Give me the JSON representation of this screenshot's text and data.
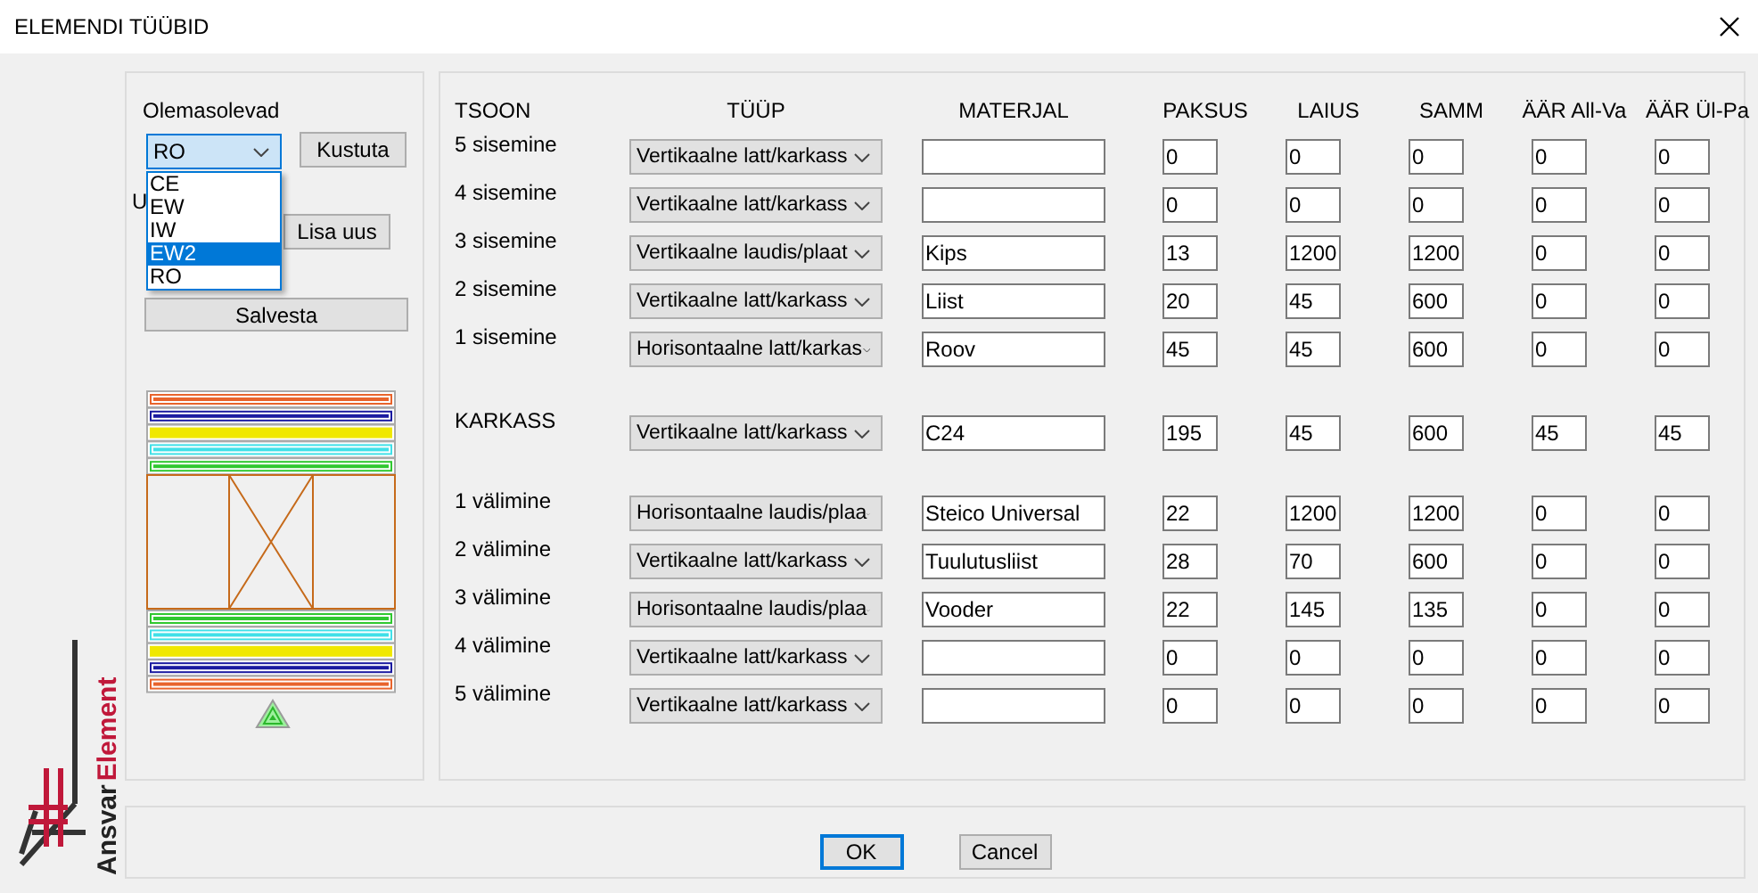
{
  "window": {
    "title": "ELEMENDI TÜÜBID"
  },
  "existing": {
    "label": "Olemasolevad",
    "value": "RO",
    "expanded": true,
    "options": [
      {
        "label": "CE",
        "highlighted": false
      },
      {
        "label": "EW",
        "highlighted": false
      },
      {
        "label": "IW",
        "highlighted": false
      },
      {
        "label": "EW2",
        "highlighted": true
      },
      {
        "label": "RO",
        "highlighted": false
      }
    ]
  },
  "new_label": "U",
  "buttons": {
    "delete": "Kustuta",
    "add": "Lisa uus",
    "save": "Salvesta"
  },
  "table": {
    "columns": [
      "TSOON",
      "TÜÜP",
      "MATERJAL",
      "PAKSUS",
      "LAIUS",
      "SAMM",
      "ÄÄR All-Va",
      "ÄÄR Ül-Pa"
    ],
    "row_groups": [
      [
        {
          "zone": "5 sisemine",
          "type": "Vertikaalne latt/karkass",
          "values": [
            "0",
            "0",
            "0",
            "0",
            "0"
          ]
        },
        {
          "zone": "4 sisemine",
          "type": "Vertikaalne latt/karkass",
          "values": [
            "0",
            "0",
            "0",
            "0",
            "0"
          ]
        },
        {
          "zone": "3 sisemine",
          "type": "Vertikaalne laudis/plaat",
          "material": "Kips",
          "values": [
            "13",
            "1200",
            "1200",
            "0",
            "0"
          ]
        },
        {
          "zone": "2 sisemine",
          "type": "Vertikaalne latt/karkass",
          "material": "Liist",
          "values": [
            "20",
            "45",
            "600",
            "0",
            "0"
          ]
        },
        {
          "zone": "1 sisemine",
          "type": "Horisontaalne latt/karkas",
          "material": "Roov",
          "values": [
            "45",
            "45",
            "600",
            "0",
            "0"
          ]
        }
      ],
      [
        {
          "zone": "KARKASS",
          "type": "Vertikaalne latt/karkass",
          "material": "C24",
          "values": [
            "195",
            "45",
            "600",
            "45",
            "45"
          ]
        }
      ],
      [
        {
          "zone": "1 välimine",
          "type": "Horisontaalne laudis/plaa",
          "material": "Steico Universal",
          "values": [
            "22",
            "1200",
            "1200",
            "0",
            "0"
          ]
        },
        {
          "zone": "2 välimine",
          "type": "Vertikaalne latt/karkass",
          "material": "Tuulutusliist",
          "values": [
            "28",
            "70",
            "600",
            "0",
            "0"
          ]
        },
        {
          "zone": "3 välimine",
          "type": "Horisontaalne laudis/plaa",
          "material": "Vooder",
          "values": [
            "22",
            "145",
            "135",
            "0",
            "0"
          ]
        },
        {
          "zone": "4 välimine",
          "type": "Vertikaalne latt/karkass",
          "values": [
            "0",
            "0",
            "0",
            "0",
            "0"
          ]
        },
        {
          "zone": "5 välimine",
          "type": "Vertikaalne latt/karkass",
          "values": [
            "0",
            "0",
            "0",
            "0",
            "0"
          ]
        }
      ]
    ]
  },
  "footer": [
    {
      "label": "OK",
      "default": true
    },
    {
      "label": "Cancel",
      "default": false
    }
  ],
  "brand": {
    "name": "Ansvar",
    "product": "Element"
  }
}
